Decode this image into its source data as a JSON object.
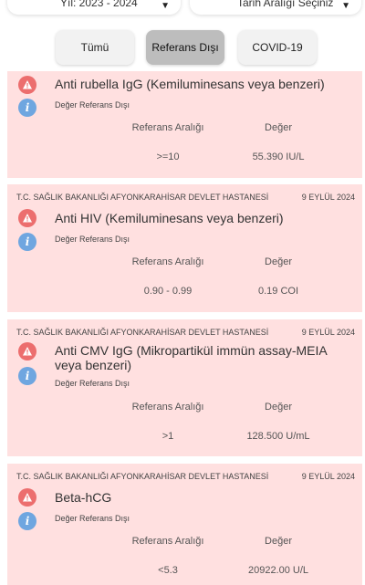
{
  "filters": {
    "year": "Yıl: 2023 - 2024",
    "date": "Tarih Aralığı Seçiniz"
  },
  "tabs": [
    {
      "label": "Tümü",
      "active": false
    },
    {
      "label": "Referans Dışı",
      "active": true
    },
    {
      "label": "COVID-19",
      "active": false
    }
  ],
  "labels": {
    "out_of_range": "Değer Referans Dışı",
    "range_header": "Referans Aralığı",
    "value_header": "Değer"
  },
  "results": [
    {
      "hospital": "",
      "date": "",
      "test": "Anti rubella IgG (Kemiluminesans veya benzeri)",
      "range": ">=10",
      "value": "55.390 IU/L"
    },
    {
      "hospital": "T.C. SAĞLIK BAKANLIĞI AFYONKARAHİSAR DEVLET HASTANESİ",
      "date": "9 EYLÜL 2024",
      "test": "Anti HIV (Kemiluminesans veya benzeri)",
      "range": "0.90 - 0.99",
      "value": "0.19 COI"
    },
    {
      "hospital": "T.C. SAĞLIK BAKANLIĞI AFYONKARAHİSAR DEVLET HASTANESİ",
      "date": "9 EYLÜL 2024",
      "test": "Anti CMV IgG (Mikropartikül immün assay-MEIA veya benzeri)",
      "range": ">1",
      "value": "128.500 U/mL"
    },
    {
      "hospital": "T.C. SAĞLIK BAKANLIĞI AFYONKARAHİSAR DEVLET HASTANESİ",
      "date": "9 EYLÜL 2024",
      "test": "Beta-hCG",
      "range": "<5.3",
      "value": "20922.00 U/L"
    }
  ],
  "colors": {
    "card_bg": "#ffe0e0",
    "warning_icon": "#ec6e6e",
    "info_icon": "#6fa6e0",
    "active_tab": "#bdbdbd"
  }
}
